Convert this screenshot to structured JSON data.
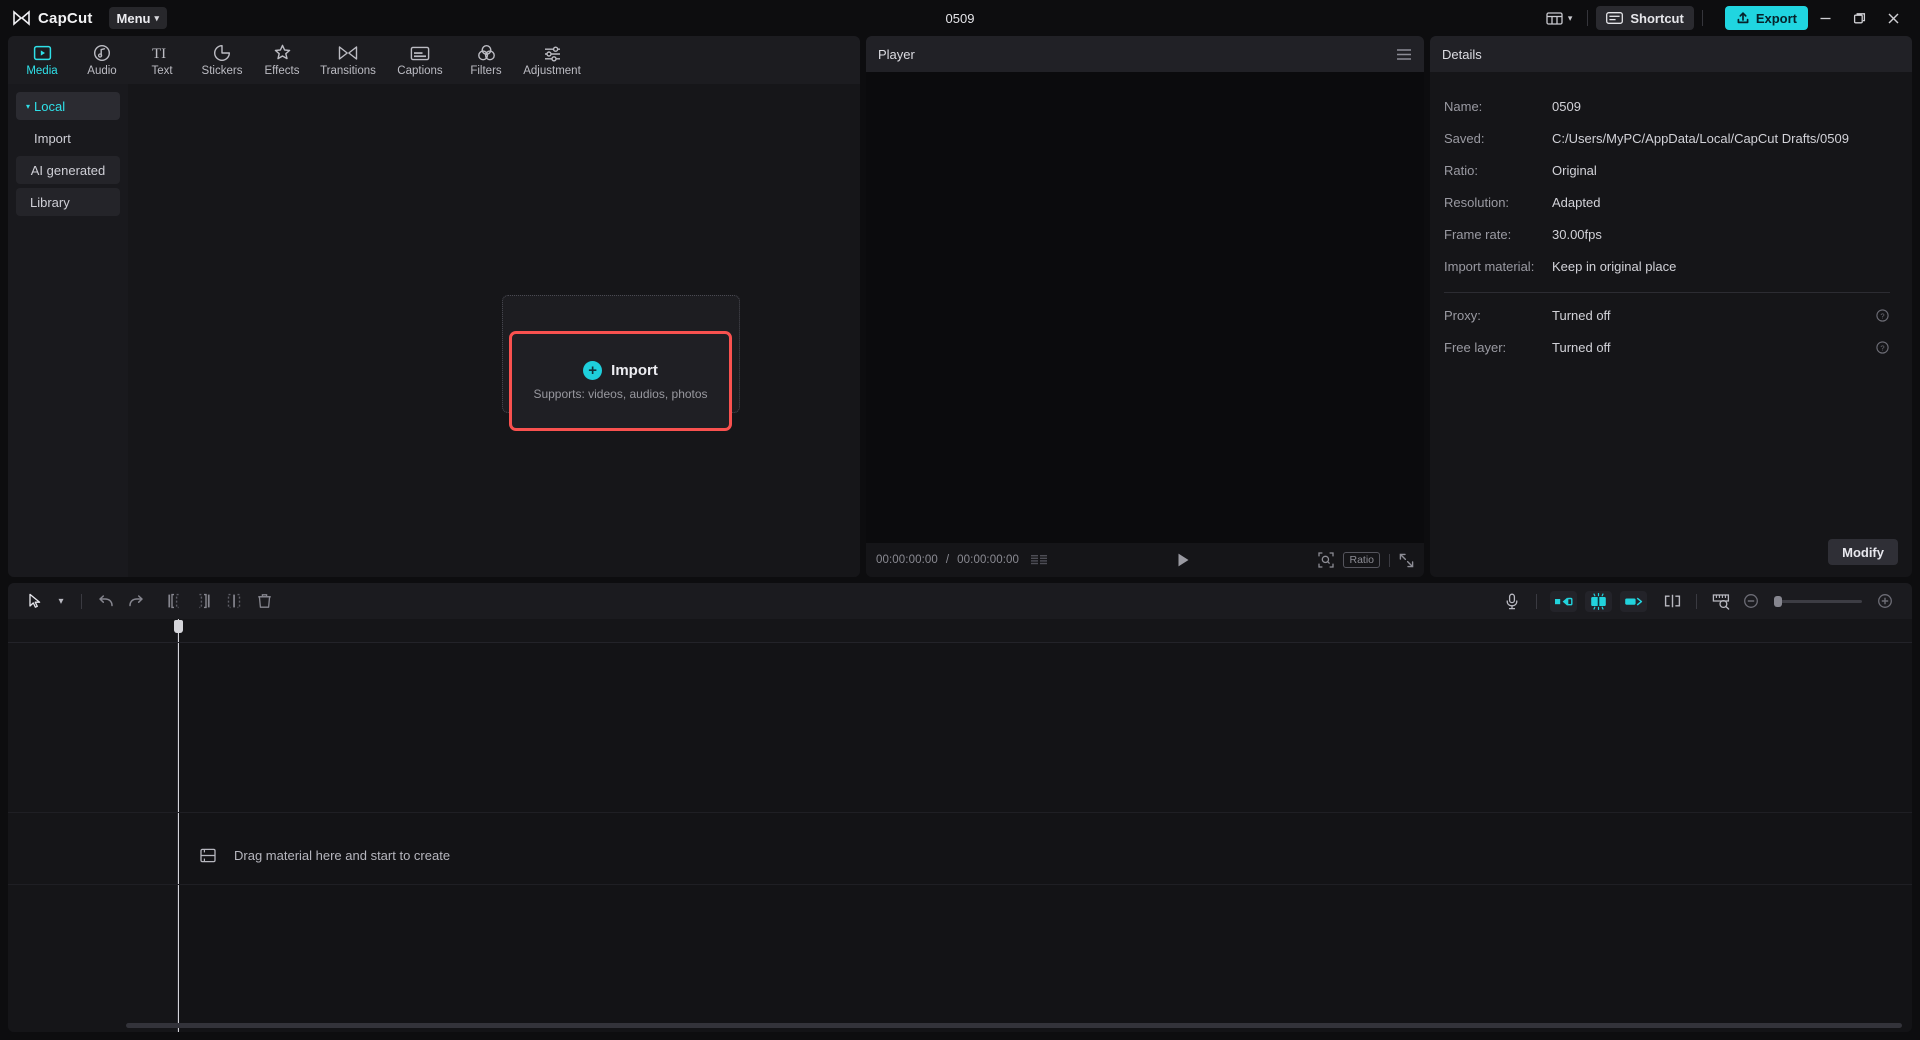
{
  "titlebar": {
    "brand": "CapCut",
    "brand_logo_icon": "capcut-logo-icon",
    "menu_label": "Menu",
    "menu_caret_icon": "chevron-down-icon",
    "document_title": "0509",
    "layout_icon": "layout-panels-icon",
    "layout_caret_icon": "chevron-down-icon",
    "shortcut_label": "Shortcut",
    "shortcut_icon": "keyboard-icon",
    "export_label": "Export",
    "export_icon": "upload-icon",
    "minimize_icon": "minimize-icon",
    "maximize_icon": "maximize-icon",
    "close_icon": "close-icon",
    "accent": "#20d5e0"
  },
  "tabs": [
    {
      "label": "Media",
      "icon": "media-play-box-icon",
      "active": true
    },
    {
      "label": "Audio",
      "icon": "audio-note-icon",
      "active": false
    },
    {
      "label": "Text",
      "icon": "text-ti-icon",
      "active": false
    },
    {
      "label": "Stickers",
      "icon": "sticker-circle-icon",
      "active": false
    },
    {
      "label": "Effects",
      "icon": "effects-sparkle-icon",
      "active": false
    },
    {
      "label": "Transitions",
      "icon": "transitions-bowtie-icon",
      "active": false
    },
    {
      "label": "Captions",
      "icon": "captions-box-icon",
      "active": false
    },
    {
      "label": "Filters",
      "icon": "filters-circles-icon",
      "active": false
    },
    {
      "label": "Adjustment",
      "icon": "adjustment-sliders-icon",
      "active": false
    }
  ],
  "media_sidebar": {
    "items": [
      {
        "label": "Local",
        "selected": true,
        "has_caret": true,
        "boxed": false
      },
      {
        "label": "Import",
        "selected": false,
        "has_caret": false,
        "boxed": false
      },
      {
        "label": "AI generated",
        "selected": false,
        "has_caret": false,
        "boxed": true
      },
      {
        "label": "Library",
        "selected": false,
        "has_caret": false,
        "boxed": true
      }
    ]
  },
  "import_card": {
    "title": "Import",
    "subtitle": "Supports: videos, audios, photos",
    "plus_icon": "plus-circle-icon",
    "highlight_color": "#f9514f"
  },
  "player": {
    "title": "Player",
    "menu_icon": "hamburger-menu-icon",
    "current_time": "00:00:00:00",
    "separator": "/",
    "total_time": "00:00:00:00",
    "list_icon": "frames-list-icon",
    "play_icon": "play-icon",
    "crop_icon": "crop-zoom-icon",
    "ratio_label": "Ratio",
    "fullscreen_icon": "fullscreen-icon"
  },
  "details": {
    "title": "Details",
    "rows": [
      {
        "key": "Name:",
        "value": "0509",
        "help": false
      },
      {
        "key": "Saved:",
        "value": "C:/Users/MyPC/AppData/Local/CapCut Drafts/0509",
        "help": false
      },
      {
        "key": "Ratio:",
        "value": "Original",
        "help": false
      },
      {
        "key": "Resolution:",
        "value": "Adapted",
        "help": false
      },
      {
        "key": "Frame rate:",
        "value": "30.00fps",
        "help": false
      },
      {
        "key": "Import material:",
        "value": "Keep in original place",
        "help": false
      }
    ],
    "rows_secondary": [
      {
        "key": "Proxy:",
        "value": "Turned off",
        "help": true,
        "help_icon": "question-circle-icon"
      },
      {
        "key": "Free layer:",
        "value": "Turned off",
        "help": true,
        "help_icon": "question-circle-icon"
      }
    ],
    "modify_label": "Modify"
  },
  "timeline": {
    "toolbar_left": [
      {
        "name": "select-tool",
        "icon": "cursor-arrow-icon"
      },
      {
        "name": "select-tool-dropdown",
        "icon": "chevron-down-icon"
      },
      {
        "name": "undo",
        "icon": "undo-icon"
      },
      {
        "name": "redo",
        "icon": "redo-icon"
      },
      {
        "name": "split-left",
        "icon": "trim-left-icon"
      },
      {
        "name": "split-right",
        "icon": "trim-right-icon"
      },
      {
        "name": "split-clip",
        "icon": "split-icon"
      },
      {
        "name": "delete",
        "icon": "trash-icon"
      }
    ],
    "toolbar_right": [
      {
        "name": "record-voiceover",
        "icon": "microphone-icon",
        "active": false
      },
      {
        "name": "mirror-left",
        "icon": "keyframe-left-icon",
        "active": true
      },
      {
        "name": "auto-snap",
        "icon": "magnet-snap-icon",
        "active": true
      },
      {
        "name": "mirror-right",
        "icon": "keyframe-right-icon",
        "active": true
      },
      {
        "name": "split-marker",
        "icon": "split-marker-icon",
        "active": false
      },
      {
        "name": "ruler-preview",
        "icon": "ruler-magnifier-icon",
        "active": false
      },
      {
        "name": "zoom-out",
        "icon": "zoom-out-icon",
        "active": false
      },
      {
        "name": "zoom-in",
        "icon": "zoom-in-icon",
        "active": false
      }
    ],
    "zoom_value": 0,
    "drag_hint": "Drag material here and start to create",
    "drag_hint_icon": "filmstrip-icon"
  }
}
